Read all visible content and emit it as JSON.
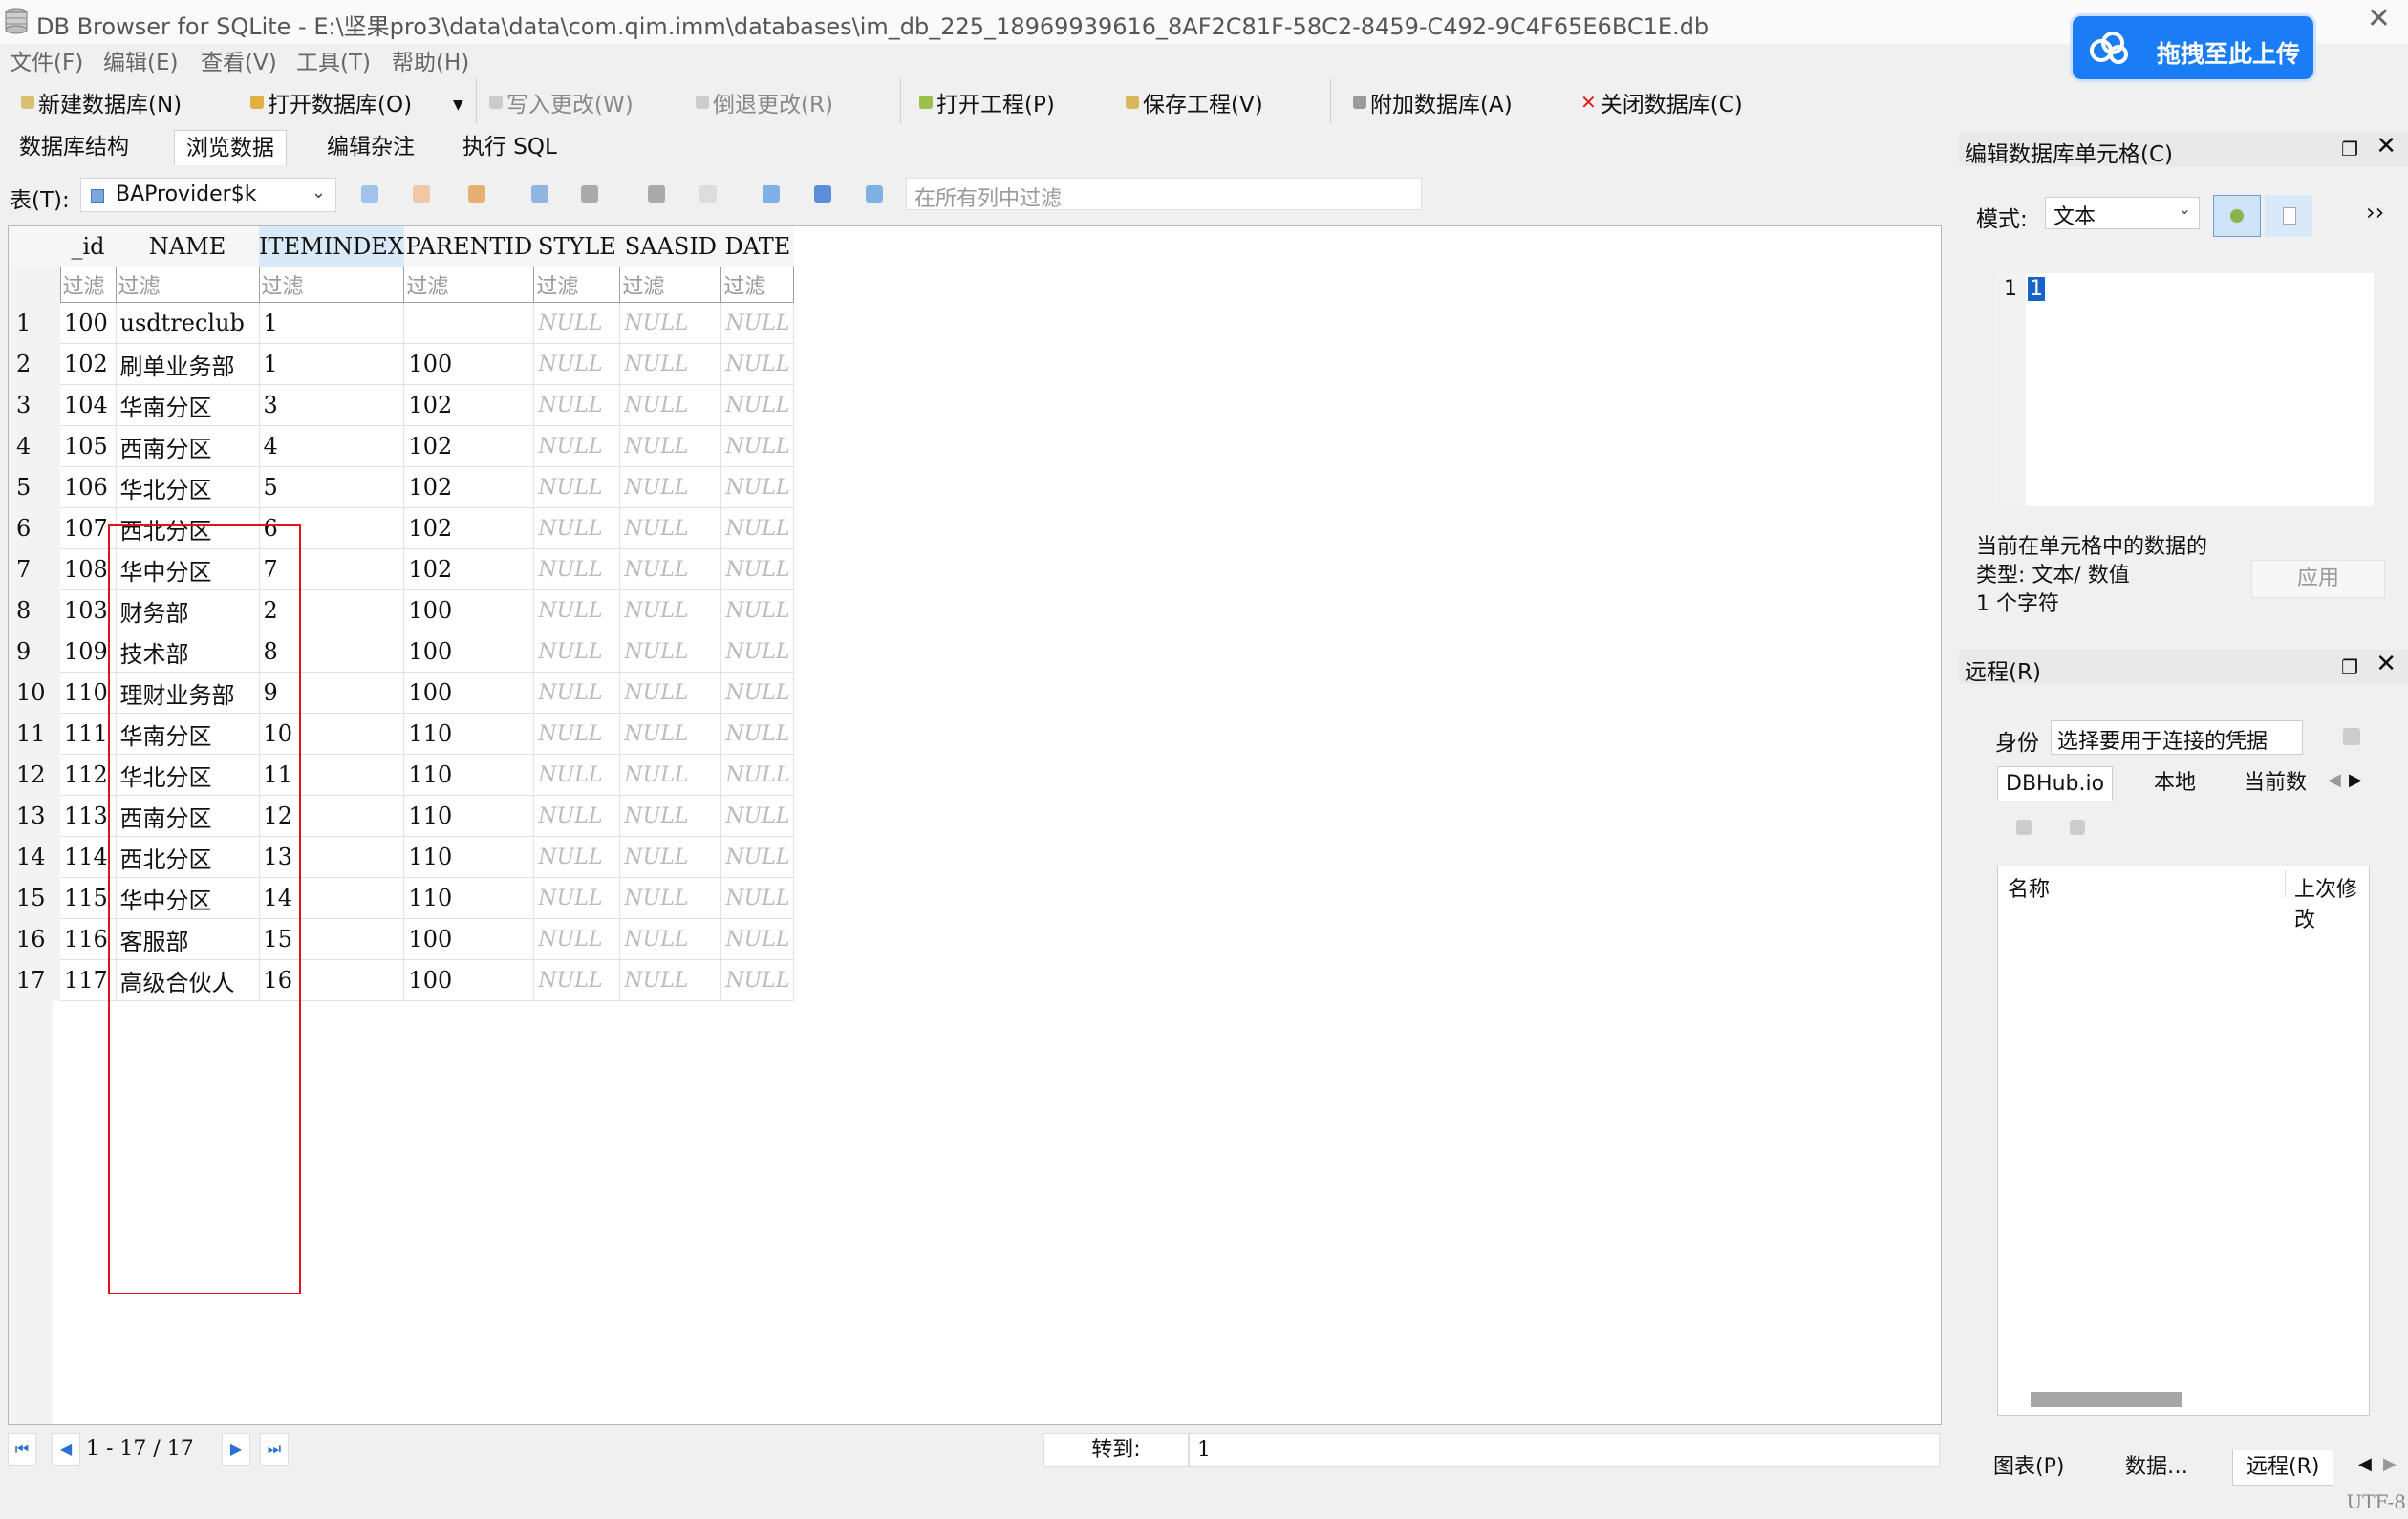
{
  "window": {
    "title": "DB Browser for SQLite - E:\\坚果pro3\\data\\data\\com.qim.imm\\databases\\im_db_225_18969939616_8AF2C81F-58C2-8459-C492-9C4F65E6BC1E.db"
  },
  "upload_badge": {
    "label": "拖拽至此上传"
  },
  "menu": [
    "文件(F)",
    "编辑(E)",
    "查看(V)",
    "工具(T)",
    "帮助(H)"
  ],
  "toolbar": {
    "new_db": "新建数据库(N)",
    "open_db": "打开数据库(O)",
    "write_changes": "写入更改(W)",
    "revert_changes": "倒退更改(R)",
    "open_project": "打开工程(P)",
    "save_project": "保存工程(V)",
    "attach_db": "附加数据库(A)",
    "close_db": "关闭数据库(C)"
  },
  "tabs": [
    "数据库结构",
    "浏览数据",
    "编辑杂注",
    "执行 SQL"
  ],
  "active_tab": "浏览数据",
  "browse": {
    "table_label": "表(T):",
    "table_name": "BAProvider$k",
    "global_filter_placeholder": "在所有列中过滤",
    "columns": [
      "_id",
      "NAME",
      "ITEMINDEX",
      "PARENTID",
      "STYLE",
      "SAASID",
      "DATE"
    ],
    "selected_column": "ITEMINDEX",
    "filter_placeholder": "过滤",
    "rows": [
      [
        "100",
        "usdtreclub",
        "1",
        "",
        "NULL",
        "NULL",
        "NULL"
      ],
      [
        "102",
        "刷单业务部",
        "1",
        "100",
        "NULL",
        "NULL",
        "NULL"
      ],
      [
        "104",
        "华南分区",
        "3",
        "102",
        "NULL",
        "NULL",
        "NULL"
      ],
      [
        "105",
        "西南分区",
        "4",
        "102",
        "NULL",
        "NULL",
        "NULL"
      ],
      [
        "106",
        "华北分区",
        "5",
        "102",
        "NULL",
        "NULL",
        "NULL"
      ],
      [
        "107",
        "西北分区",
        "6",
        "102",
        "NULL",
        "NULL",
        "NULL"
      ],
      [
        "108",
        "华中分区",
        "7",
        "102",
        "NULL",
        "NULL",
        "NULL"
      ],
      [
        "103",
        "财务部",
        "2",
        "100",
        "NULL",
        "NULL",
        "NULL"
      ],
      [
        "109",
        "技术部",
        "8",
        "100",
        "NULL",
        "NULL",
        "NULL"
      ],
      [
        "110",
        "理财业务部",
        "9",
        "100",
        "NULL",
        "NULL",
        "NULL"
      ],
      [
        "111",
        "华南分区",
        "10",
        "110",
        "NULL",
        "NULL",
        "NULL"
      ],
      [
        "112",
        "华北分区",
        "11",
        "110",
        "NULL",
        "NULL",
        "NULL"
      ],
      [
        "113",
        "西南分区",
        "12",
        "110",
        "NULL",
        "NULL",
        "NULL"
      ],
      [
        "114",
        "西北分区",
        "13",
        "110",
        "NULL",
        "NULL",
        "NULL"
      ],
      [
        "115",
        "华中分区",
        "14",
        "110",
        "NULL",
        "NULL",
        "NULL"
      ],
      [
        "116",
        "客服部",
        "15",
        "100",
        "NULL",
        "NULL",
        "NULL"
      ],
      [
        "117",
        "高级合伙人",
        "16",
        "100",
        "NULL",
        "NULL",
        "NULL"
      ]
    ],
    "pager": {
      "range": "1 - 17 / 17",
      "goto_label": "转到:",
      "goto_value": "1"
    }
  },
  "edit_cell": {
    "title": "编辑数据库单元格(C)",
    "mode_label": "模式:",
    "mode_value": "文本",
    "more": "››",
    "line_number": "1",
    "content": "1",
    "type_line1": "当前在单元格中的数据的",
    "type_line2": "类型: 文本/ 数值",
    "char_count": "1 个字符",
    "apply": "应用"
  },
  "remote": {
    "title": "远程(R)",
    "identity_label": "身份",
    "identity_value": "选择要用于连接的凭据",
    "tabs": [
      "DBHub.io",
      "本地",
      "当前数"
    ],
    "columns": [
      "名称",
      "上次修改"
    ]
  },
  "bottom_tabs": [
    "图表(P)",
    "数据…",
    "远程(R)"
  ],
  "status": {
    "encoding": "UTF-8"
  }
}
